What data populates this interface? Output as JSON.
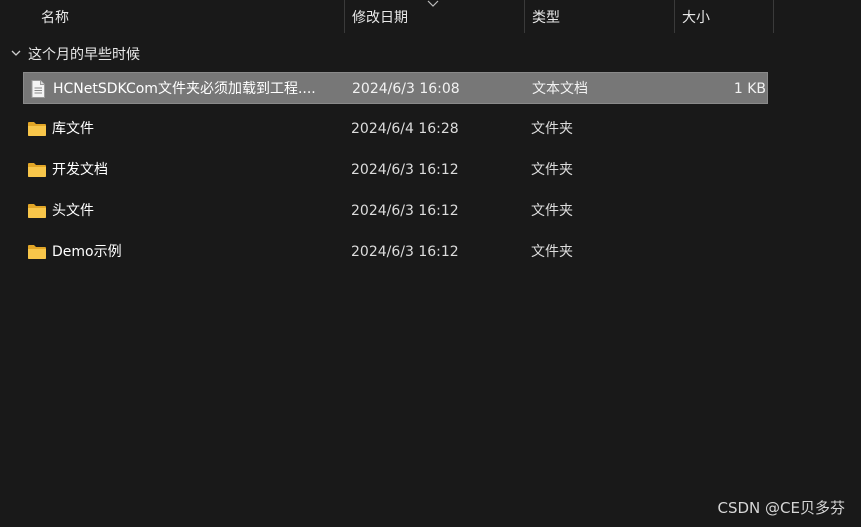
{
  "columns": {
    "name": "名称",
    "date": "修改日期",
    "type": "类型",
    "size": "大小"
  },
  "group": {
    "label": "这个月的早些时候",
    "icon": "chevron-down-icon"
  },
  "files": [
    {
      "name": "HCNetSDKCom文件夹必须加载到工程....",
      "date": "2024/6/3 16:08",
      "type": "文本文档",
      "size": "1 KB",
      "icon": "text-document-icon",
      "selected": true
    },
    {
      "name": "库文件",
      "date": "2024/6/4 16:28",
      "type": "文件夹",
      "size": "",
      "icon": "folder-icon",
      "selected": false
    },
    {
      "name": "开发文档",
      "date": "2024/6/3 16:12",
      "type": "文件夹",
      "size": "",
      "icon": "folder-icon",
      "selected": false
    },
    {
      "name": "头文件",
      "date": "2024/6/3 16:12",
      "type": "文件夹",
      "size": "",
      "icon": "folder-icon",
      "selected": false
    },
    {
      "name": "Demo示例",
      "date": "2024/6/3 16:12",
      "type": "文件夹",
      "size": "",
      "icon": "folder-icon",
      "selected": false
    }
  ],
  "watermark": "CSDN @CE贝多芬",
  "colors": {
    "background": "#191919",
    "selection": "#777777",
    "folder": "#f8c64a"
  }
}
